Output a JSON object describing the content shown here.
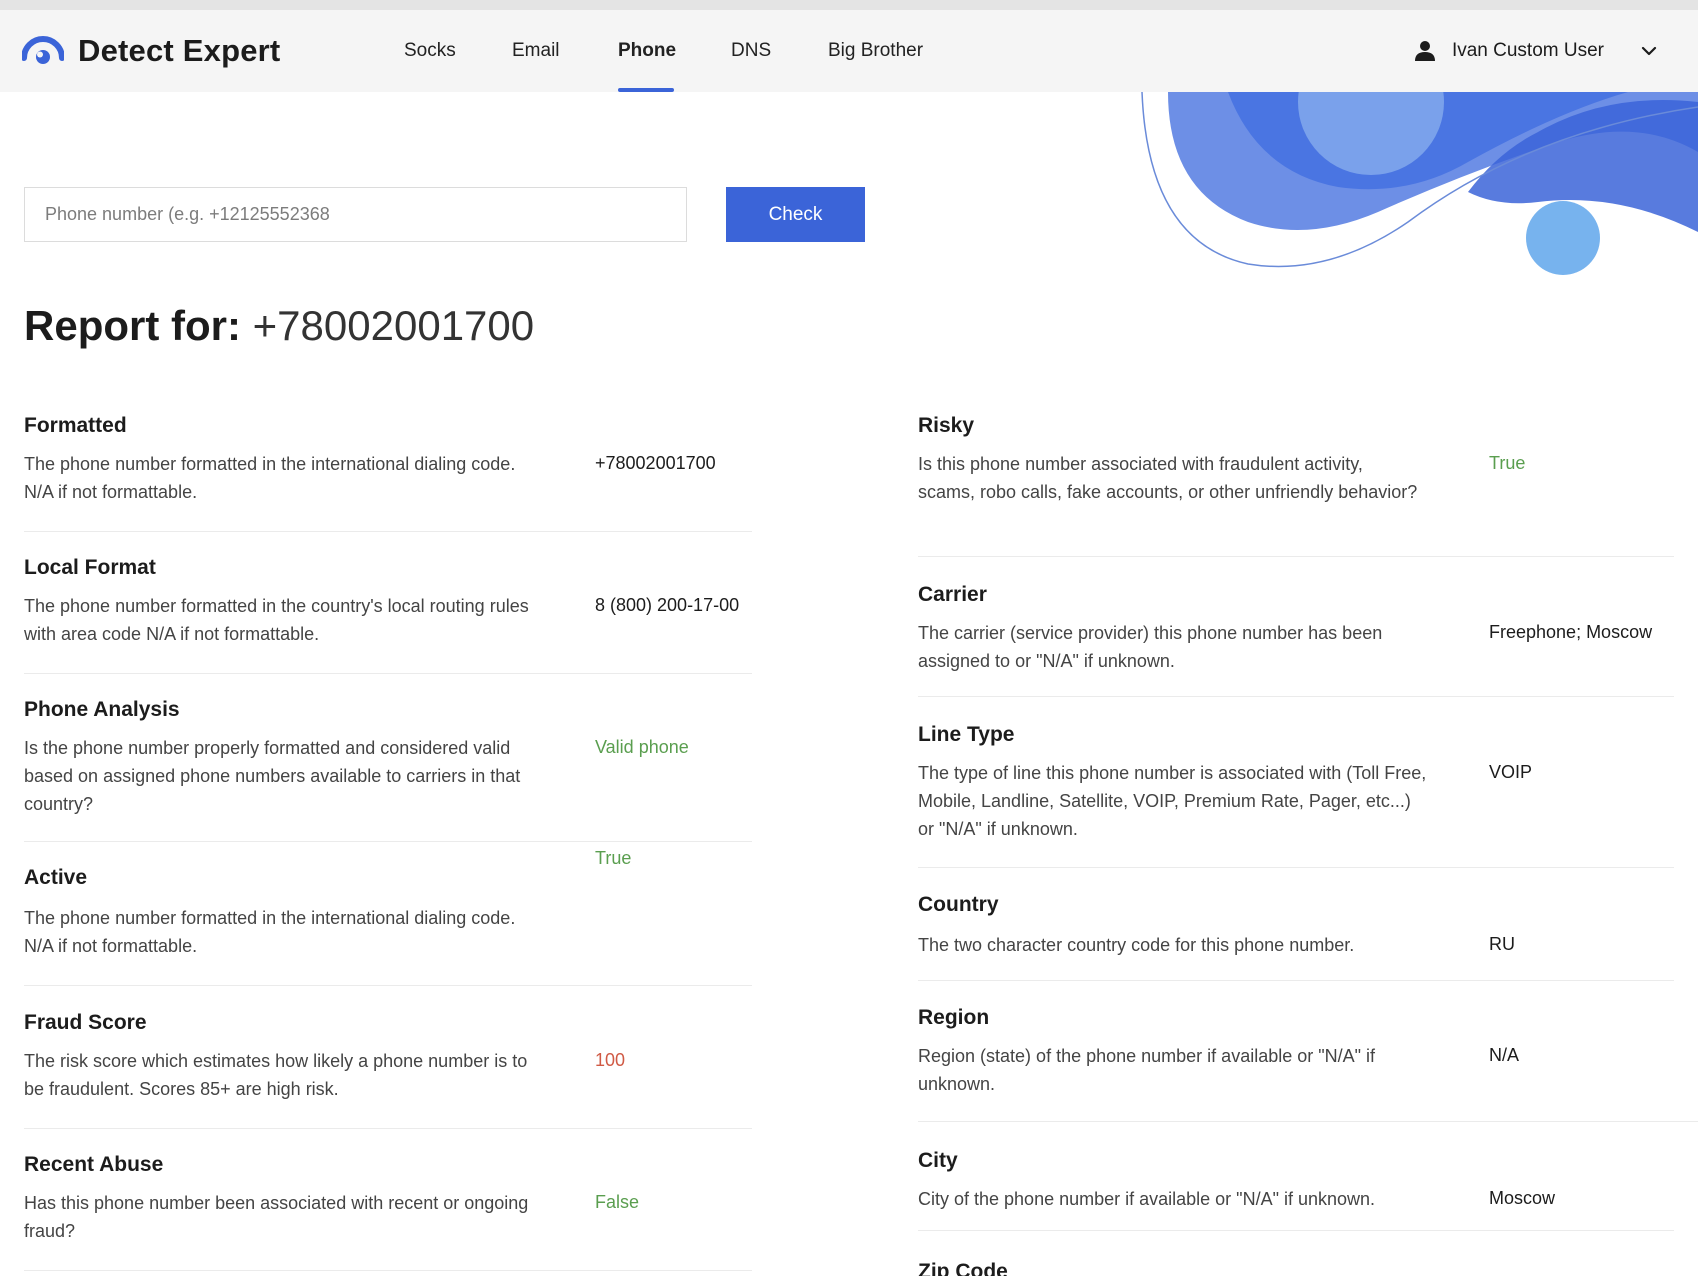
{
  "brand": {
    "name": "Detect Expert"
  },
  "nav": {
    "items": [
      {
        "label": "Socks",
        "active": false
      },
      {
        "label": "Email",
        "active": false
      },
      {
        "label": "Phone",
        "active": true
      },
      {
        "label": "DNS",
        "active": false
      },
      {
        "label": "Big Brother",
        "active": false
      }
    ]
  },
  "user": {
    "name": "Ivan Custom User",
    "icon": "user-icon"
  },
  "search": {
    "placeholder": "Phone number (e.g. +12125552368",
    "value": "",
    "button_label": "Check"
  },
  "report": {
    "label": "Report for:",
    "number": "+78002001700"
  },
  "left_fields": [
    {
      "title": "Formatted",
      "description": "The phone number formatted in the international dialing code. N/A if not formattable.",
      "value": "+78002001700",
      "value_color": "default"
    },
    {
      "title": "Local Format",
      "description": "The phone number formatted in the country's local routing rules with area code N/A if not formattable.",
      "value": "8 (800) 200-17-00",
      "value_color": "default"
    },
    {
      "title": "Phone Analysis",
      "description": "Is the phone number properly formatted and considered valid based on assigned phone numbers available to carriers in that country?",
      "value": "Valid phone",
      "value_color": "green"
    },
    {
      "title": "Active",
      "description": "The phone number formatted in the international dialing code. N/A if not formattable.",
      "value": "True",
      "value_color": "green"
    },
    {
      "title": "Fraud Score",
      "description": "The risk score which estimates how likely a phone number is to be fraudulent. Scores 85+ are high risk.",
      "value": "100",
      "value_color": "red"
    },
    {
      "title": "Recent Abuse",
      "description": "Has this phone number been associated with recent or ongoing fraud?",
      "value": "False",
      "value_color": "green"
    }
  ],
  "right_fields": [
    {
      "title": "Risky",
      "description": "Is this phone number associated with fraudulent activity, scams, robo calls, fake accounts, or other unfriendly behavior?",
      "value": "True",
      "value_color": "green"
    },
    {
      "title": "Carrier",
      "description": "The carrier (service provider) this phone number has been assigned to or \"N/A\" if unknown.",
      "value": "Freephone; Moscow",
      "value_color": "default"
    },
    {
      "title": "Line Type",
      "description": "The type of line this phone number is associated with (Toll Free, Mobile, Landline, Satellite, VOIP, Premium Rate, Pager, etc...) or \"N/A\" if unknown.",
      "value": "VOIP",
      "value_color": "default"
    },
    {
      "title": "Country",
      "description": "The two character country code for this phone number.",
      "value": "RU",
      "value_color": "default"
    },
    {
      "title": "Region",
      "description": "Region (state) of the phone number if available or \"N/A\" if unknown.",
      "value": "N/A",
      "value_color": "default"
    },
    {
      "title": "City",
      "description": "City of the phone number if available or \"N/A\" if unknown.",
      "value": "Moscow",
      "value_color": "default"
    },
    {
      "title": "Zip Code",
      "description": "",
      "value": "",
      "value_color": "default"
    }
  ],
  "colors": {
    "accent": "#3b64d8",
    "green": "#5a9e4f",
    "red": "#d05a45"
  }
}
